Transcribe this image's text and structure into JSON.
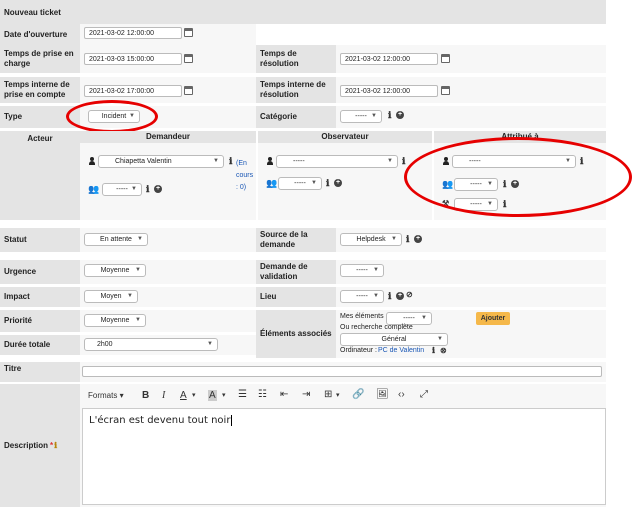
{
  "header": {
    "title": "Nouveau ticket"
  },
  "fields": {
    "date_ouverture": {
      "label": "Date d'ouverture",
      "value": "2021-03-02 12:00:00"
    },
    "prise_en_charge": {
      "label": "Temps de prise en charge",
      "value": "2021-03-03 15:00:00"
    },
    "resolution": {
      "label": "Temps de résolution",
      "value": "2021-03-02 12:00:00"
    },
    "interne_prise": {
      "label": "Temps interne de prise en compte",
      "value": "2021-03-02 17:00:00"
    },
    "interne_resolution": {
      "label": "Temps interne de résolution",
      "value": "2021-03-02 12:00:00"
    },
    "type": {
      "label": "Type",
      "value": "Incident"
    },
    "categorie": {
      "label": "Catégorie",
      "value": "-----"
    },
    "statut": {
      "label": "Statut",
      "value": "En attente"
    },
    "source": {
      "label": "Source de la demande",
      "value": "Helpdesk"
    },
    "urgence": {
      "label": "Urgence",
      "value": "Moyenne"
    },
    "validation": {
      "label": "Demande de validation",
      "value": "-----"
    },
    "impact": {
      "label": "Impact",
      "value": "Moyen"
    },
    "lieu": {
      "label": "Lieu",
      "value": "-----"
    },
    "priorite": {
      "label": "Priorité",
      "value": "Moyenne"
    },
    "elements": {
      "label": "Éléments associés",
      "mes_elements": "Mes éléments",
      "mes_value": "-----",
      "ou_recherche": "Ou recherche complète",
      "general": "Général",
      "ordinateur_label": "Ordinateur :",
      "ordinateur_value": "PC de Valentin",
      "ajouter": "Ajouter"
    },
    "duree": {
      "label": "Durée totale",
      "value": "2h00"
    },
    "titre": {
      "label": "Titre",
      "value": ""
    },
    "description": {
      "label": "Description",
      "required": "*",
      "text": "L'écran est devenu tout noir"
    }
  },
  "acteur": {
    "label": "Acteur",
    "demandeur": {
      "header": "Demandeur",
      "user": "Chiapetta Valentin",
      "status": "(En cours : 0)",
      "group": "-----"
    },
    "observateur": {
      "header": "Observateur",
      "user": "-----",
      "group": "-----"
    },
    "attribue": {
      "header": "Attribué à",
      "user": "-----",
      "group": "-----",
      "supplier": "-----"
    }
  },
  "toolbar": {
    "formats": "Formats"
  }
}
